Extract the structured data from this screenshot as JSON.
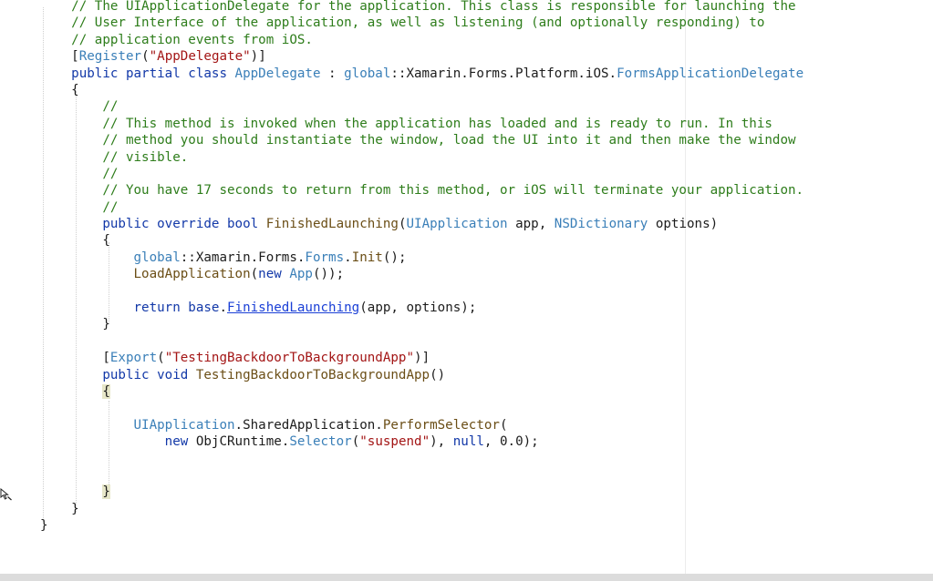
{
  "editor": {
    "lines": [
      [
        {
          "t": "    "
        },
        {
          "t": "// The UIApplicationDelegate for the application. This class is responsible for launching the",
          "c": "comment"
        }
      ],
      [
        {
          "t": "    "
        },
        {
          "t": "// User Interface of the application, as well as listening (and optionally responding) to",
          "c": "comment"
        }
      ],
      [
        {
          "t": "    "
        },
        {
          "t": "// application events from iOS.",
          "c": "comment"
        }
      ],
      [
        {
          "t": "    "
        },
        {
          "t": "[",
          "c": "plain"
        },
        {
          "t": "Register",
          "c": "type"
        },
        {
          "t": "(",
          "c": "plain"
        },
        {
          "t": "\"AppDelegate\"",
          "c": "string"
        },
        {
          "t": ")]",
          "c": "plain"
        }
      ],
      [
        {
          "t": "    "
        },
        {
          "t": "public partial class ",
          "c": "keyword"
        },
        {
          "t": "AppDelegate",
          "c": "type"
        },
        {
          "t": " : ",
          "c": "plain"
        },
        {
          "t": "global",
          "c": "type"
        },
        {
          "t": "::Xamarin.Forms.Platform.iOS.",
          "c": "plain"
        },
        {
          "t": "FormsApplicationDelegate",
          "c": "type"
        }
      ],
      [
        {
          "t": "    {",
          "c": "plain"
        }
      ],
      [
        {
          "t": "        "
        },
        {
          "t": "//",
          "c": "comment"
        }
      ],
      [
        {
          "t": "        "
        },
        {
          "t": "// This method is invoked when the application has loaded and is ready to run. In this",
          "c": "comment"
        }
      ],
      [
        {
          "t": "        "
        },
        {
          "t": "// method you should instantiate the window, load the UI into it and then make the window",
          "c": "comment"
        }
      ],
      [
        {
          "t": "        "
        },
        {
          "t": "// visible.",
          "c": "comment"
        }
      ],
      [
        {
          "t": "        "
        },
        {
          "t": "//",
          "c": "comment"
        }
      ],
      [
        {
          "t": "        "
        },
        {
          "t": "// You have 17 seconds to return from this method, or iOS will terminate your application.",
          "c": "comment"
        }
      ],
      [
        {
          "t": "        "
        },
        {
          "t": "//",
          "c": "comment"
        }
      ],
      [
        {
          "t": "        "
        },
        {
          "t": "public override bool ",
          "c": "keyword"
        },
        {
          "t": "FinishedLaunching",
          "c": "method"
        },
        {
          "t": "(",
          "c": "plain"
        },
        {
          "t": "UIApplication",
          "c": "type"
        },
        {
          "t": " app, ",
          "c": "plain"
        },
        {
          "t": "NSDictionary",
          "c": "type"
        },
        {
          "t": " options)",
          "c": "plain"
        }
      ],
      [
        {
          "t": "        {",
          "c": "plain"
        }
      ],
      [
        {
          "t": "            "
        },
        {
          "t": "global",
          "c": "type"
        },
        {
          "t": "::Xamarin.Forms.",
          "c": "plain"
        },
        {
          "t": "Forms",
          "c": "type"
        },
        {
          "t": ".",
          "c": "plain"
        },
        {
          "t": "Init",
          "c": "method"
        },
        {
          "t": "();",
          "c": "plain"
        }
      ],
      [
        {
          "t": "            "
        },
        {
          "t": "LoadApplication",
          "c": "method"
        },
        {
          "t": "(",
          "c": "plain"
        },
        {
          "t": "new ",
          "c": "keyword"
        },
        {
          "t": "App",
          "c": "type"
        },
        {
          "t": "());",
          "c": "plain"
        }
      ],
      [
        {
          "t": ""
        }
      ],
      [
        {
          "t": "            "
        },
        {
          "t": "return ",
          "c": "keyword"
        },
        {
          "t": "base",
          "c": "keyword"
        },
        {
          "t": ".",
          "c": "plain"
        },
        {
          "t": "FinishedLaunching",
          "c": "link"
        },
        {
          "t": "(app, options);",
          "c": "plain"
        }
      ],
      [
        {
          "t": "        }",
          "c": "plain"
        }
      ],
      [
        {
          "t": ""
        }
      ],
      [
        {
          "t": "        "
        },
        {
          "t": "[",
          "c": "plain"
        },
        {
          "t": "Export",
          "c": "type"
        },
        {
          "t": "(",
          "c": "plain"
        },
        {
          "t": "\"TestingBackdoorToBackgroundApp\"",
          "c": "string"
        },
        {
          "t": ")]",
          "c": "plain"
        }
      ],
      [
        {
          "t": "        "
        },
        {
          "t": "public void ",
          "c": "keyword"
        },
        {
          "t": "TestingBackdoorToBackgroundApp",
          "c": "method"
        },
        {
          "t": "()",
          "c": "plain"
        }
      ],
      [
        {
          "t": "        "
        },
        {
          "t": "{",
          "c": "brace"
        }
      ],
      [
        {
          "t": ""
        }
      ],
      [
        {
          "t": "            "
        },
        {
          "t": "UIApplication",
          "c": "type"
        },
        {
          "t": ".SharedApplication.",
          "c": "plain"
        },
        {
          "t": "PerformSelector",
          "c": "method"
        },
        {
          "t": "(",
          "c": "plain"
        }
      ],
      [
        {
          "t": "                "
        },
        {
          "t": "new ",
          "c": "keyword"
        },
        {
          "t": "ObjCRuntime.",
          "c": "plain"
        },
        {
          "t": "Selector",
          "c": "type"
        },
        {
          "t": "(",
          "c": "plain"
        },
        {
          "t": "\"suspend\"",
          "c": "string"
        },
        {
          "t": "), ",
          "c": "plain"
        },
        {
          "t": "null",
          "c": "keyword"
        },
        {
          "t": ", 0.0);",
          "c": "plain"
        }
      ],
      [
        {
          "t": ""
        }
      ],
      [
        {
          "t": ""
        }
      ],
      [
        {
          "t": "        "
        },
        {
          "t": "}",
          "c": "brace"
        }
      ],
      [
        {
          "t": "    }",
          "c": "plain"
        }
      ],
      [
        {
          "t": "}",
          "c": "plain"
        }
      ]
    ]
  },
  "icons": {
    "cursor": "pointer-cursor-icon"
  },
  "colors": {
    "comment": "#2e7d1b",
    "keyword": "#1238a8",
    "type": "#3a7fb8",
    "string": "#a31515",
    "method": "#6b4e16",
    "link": "#1a3fd6",
    "brace_highlight": "#e6e6c8"
  }
}
